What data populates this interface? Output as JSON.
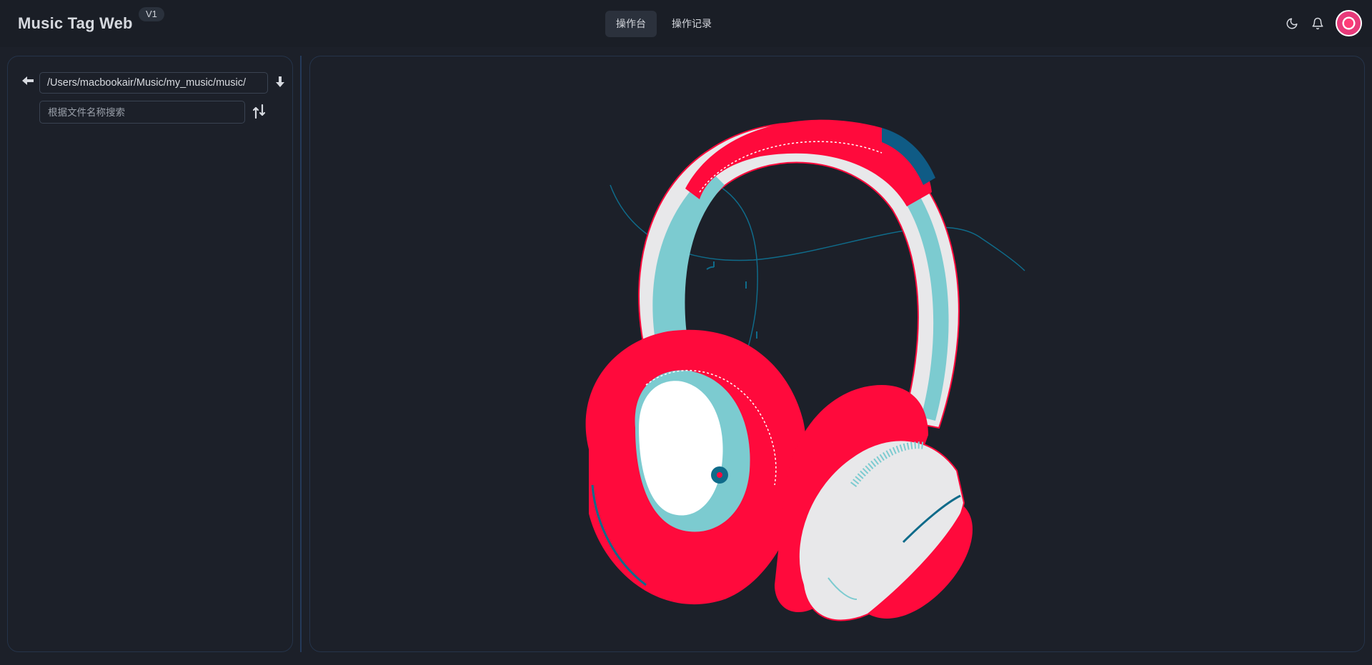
{
  "header": {
    "app_title": "Music Tag Web",
    "version": "V1",
    "tabs": [
      {
        "label": "操作台",
        "active": true
      },
      {
        "label": "操作记录",
        "active": false
      }
    ],
    "icons": {
      "theme": "moon-icon",
      "notifications": "bell-icon",
      "avatar": "avatar"
    }
  },
  "sidebar": {
    "path_value": "/Users/macbookair/Music/my_music/music/",
    "search_placeholder": "根据文件名称搜索",
    "icons": {
      "back": "arrow-left-icon",
      "download": "arrow-down-icon",
      "sort": "sort-icon"
    }
  },
  "main": {
    "illustration": "headphones-illustration"
  },
  "colors": {
    "background": "#1c2029",
    "header": "#1a1e26",
    "border": "#25344a",
    "accent_red": "#ff0a3c",
    "accent_teal": "#7ccbd0",
    "accent_blue": "#0f6b8a"
  }
}
